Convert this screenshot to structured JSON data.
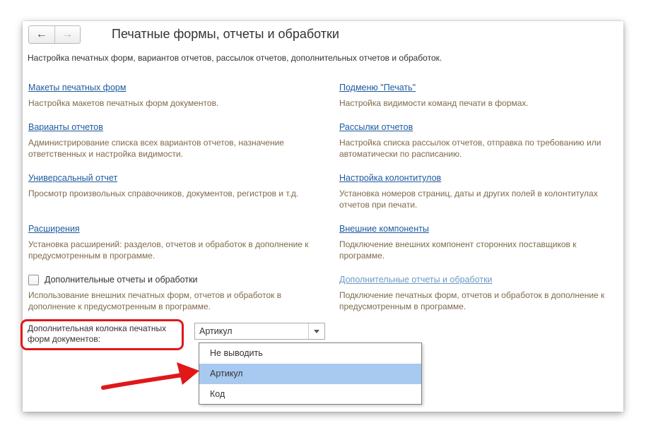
{
  "header": {
    "back_icon": "arrow-left-icon",
    "forward_icon": "arrow-right-icon",
    "title": "Печатные формы, отчеты и обработки"
  },
  "subtitle": "Настройка печатных форм, вариантов отчетов, рассылок отчетов, дополнительных отчетов и обработок.",
  "sections": {
    "left": [
      {
        "link": "Макеты печатных форм",
        "description": "Настройка макетов печатных форм документов."
      },
      {
        "link": "Варианты отчетов",
        "description": "Администрирование списка всех вариантов отчетов, назначение ответственных и настройка видимости."
      },
      {
        "link": "Универсальный отчет",
        "description": "Просмотр произвольных справочников, документов, регистров и т.д."
      },
      {
        "link": "Расширения",
        "description": "Установка расширений: разделов, отчетов и обработок в дополнение к предусмотренным в программе."
      },
      {
        "checkbox_label": "Дополнительные отчеты и обработки",
        "checked": false,
        "description": "Использование внешних печатных форм, отчетов и обработок в дополнение к предусмотренным в программе."
      }
    ],
    "right": [
      {
        "link": "Подменю \"Печать\"",
        "description": "Настройка видимости команд печати в формах."
      },
      {
        "link": "Рассылки отчетов",
        "description": "Настройка списка рассылок отчетов, отправка по требованию или автоматически по расписанию."
      },
      {
        "link": "Настройка колонтитулов",
        "description": "Установка номеров страниц, даты и других полей в колонтитулах отчетов при печати."
      },
      {
        "link": "Внешние компоненты",
        "description": "Подключение внешних компонент сторонних поставщиков к программе."
      },
      {
        "link": "Дополнительные отчеты и обработки",
        "description": "Подключение печатных форм, отчетов и обработок в дополнение к предусмотренным в программе."
      }
    ]
  },
  "extra_column": {
    "label": "Дополнительная колонка печатных форм документов:",
    "value": "Артикул",
    "dropdown_icon": "caret-down-icon",
    "options": [
      "Не выводить",
      "Артикул",
      "Код"
    ],
    "highlighted_option": "Артикул"
  },
  "annotation": {
    "highlight_color": "#e01818",
    "arrow_icon": "red-arrow-icon"
  },
  "colors": {
    "link": "#1d5a9e",
    "link_disabled": "#6d9ac7",
    "description": "#7e6a4a",
    "selection": "#a8c9f0"
  }
}
